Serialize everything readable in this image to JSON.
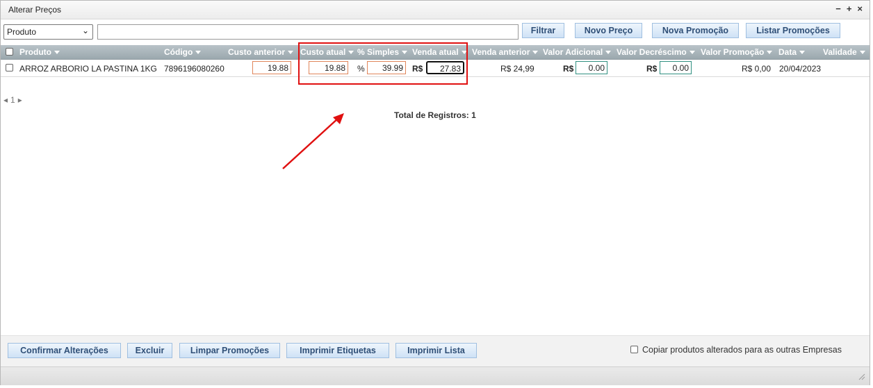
{
  "window": {
    "title": "Alterar Preços",
    "controls": [
      "−",
      "+",
      "×"
    ]
  },
  "toolbar": {
    "field_select": "Produto",
    "search_value": "",
    "filter_label": "Filtrar",
    "new_price_label": "Novo Preço",
    "new_promo_label": "Nova Promoção",
    "list_promos_label": "Listar Promoções"
  },
  "columns": {
    "produto": "Produto",
    "codigo": "Código",
    "custo_anterior": "Custo anterior",
    "custo_atual": "Custo atual",
    "percent_simples": "% Simples",
    "venda_atual": "Venda atual",
    "venda_anterior": "Venda anterior",
    "valor_adicional": "Valor Adicional",
    "valor_decrescimo": "Valor Decréscimo",
    "valor_promocao": "Valor Promoção",
    "data": "Data",
    "validade": "Validade"
  },
  "row": {
    "produto": "ARROZ ARBORIO LA PASTINA 1KG",
    "codigo": "7896196080260",
    "custo_anterior": "19.88",
    "custo_atual": "19.88",
    "percent_label": "%",
    "percent_simples": "39.99",
    "currency": "R$",
    "venda_atual": "27.83",
    "venda_anterior": "R$ 24,99",
    "valor_adicional": "0.00",
    "valor_decrescimo": "0.00",
    "valor_promocao": "R$ 0,00",
    "data": "20/04/2023",
    "validade": ""
  },
  "pager": {
    "page": "1"
  },
  "total": "Total de Registros: 1",
  "footer": {
    "confirm_label": "Confirmar Alterações",
    "delete_label": "Excluir",
    "clear_promos_label": "Limpar Promoções",
    "print_labels_label": "Imprimir Etiquetas",
    "print_list_label": "Imprimir Lista",
    "copy_label": "Copiar produtos alterados para as outras Empresas"
  },
  "colors": {
    "highlight": "#e01010",
    "button_text": "#2f4f77",
    "header_bg": "#9ba8ae"
  },
  "icons": [
    "minimize-icon",
    "maximize-icon",
    "close-icon",
    "dropdown-arrow-icon",
    "sort-caret-icon",
    "page-prev-icon",
    "page-next-icon",
    "resize-grip-icon",
    "annotation-arrow-icon"
  ]
}
